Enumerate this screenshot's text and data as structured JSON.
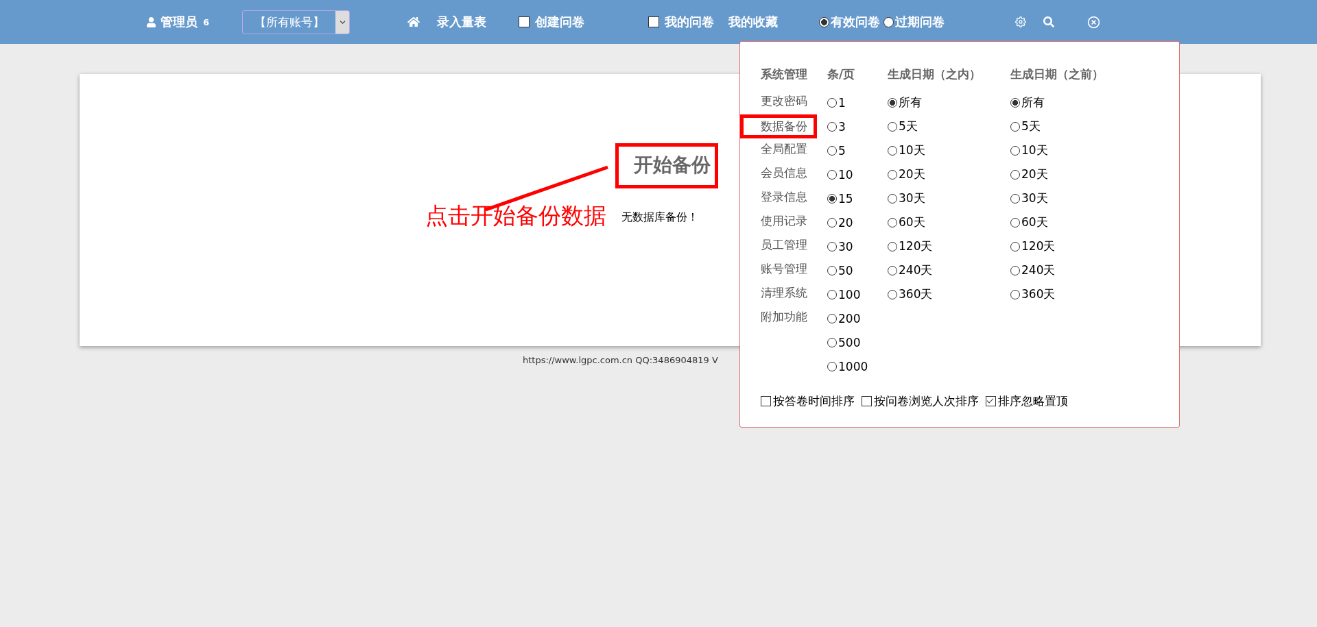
{
  "top_bar": {
    "user": {
      "label": "管理员",
      "count": "6"
    },
    "account_select": {
      "value": "【所有账号】"
    },
    "nav_links": [
      "录入量表"
    ],
    "create_check": {
      "label": "创建问卷",
      "checked": false
    },
    "mine_check": {
      "label": "我的问卷",
      "checked": false
    },
    "favorites": "我的收藏",
    "status_radios": [
      {
        "label": "有效问卷",
        "selected": true
      },
      {
        "label": "过期问卷",
        "selected": false
      }
    ]
  },
  "main": {
    "start_button": "开始备份",
    "message": "无数据库备份！",
    "annotation": "点击开始备份数据"
  },
  "footer": "https://www.lgpc.com.cn QQ:3486904819 V",
  "settings_panel": {
    "menu": {
      "title": "系统管理",
      "items": [
        {
          "label": "更改密码",
          "highlighted": false
        },
        {
          "label": "数据备份",
          "highlighted": true
        },
        {
          "label": "全局配置",
          "highlighted": false
        },
        {
          "label": "会员信息",
          "highlighted": false
        },
        {
          "label": "登录信息",
          "highlighted": false
        },
        {
          "label": "使用记录",
          "highlighted": false
        },
        {
          "label": "员工管理",
          "highlighted": false
        },
        {
          "label": "账号管理",
          "highlighted": false
        },
        {
          "label": "清理系统",
          "highlighted": false
        },
        {
          "label": "附加功能",
          "highlighted": false
        }
      ]
    },
    "per_page": {
      "title": "条/页",
      "options": [
        {
          "label": "1",
          "selected": false
        },
        {
          "label": "3",
          "selected": false
        },
        {
          "label": "5",
          "selected": false
        },
        {
          "label": "10",
          "selected": false
        },
        {
          "label": "15",
          "selected": true
        },
        {
          "label": "20",
          "selected": false
        },
        {
          "label": "30",
          "selected": false
        },
        {
          "label": "50",
          "selected": false
        },
        {
          "label": "100",
          "selected": false
        },
        {
          "label": "200",
          "selected": false
        },
        {
          "label": "500",
          "selected": false
        },
        {
          "label": "1000",
          "selected": false
        }
      ]
    },
    "date_within": {
      "title": "生成日期（之内）",
      "options": [
        {
          "label": "所有",
          "selected": true
        },
        {
          "label": "5天",
          "selected": false
        },
        {
          "label": "10天",
          "selected": false
        },
        {
          "label": "20天",
          "selected": false
        },
        {
          "label": "30天",
          "selected": false
        },
        {
          "label": "60天",
          "selected": false
        },
        {
          "label": "120天",
          "selected": false
        },
        {
          "label": "240天",
          "selected": false
        },
        {
          "label": "360天",
          "selected": false
        }
      ]
    },
    "date_before": {
      "title": "生成日期（之前）",
      "options": [
        {
          "label": "所有",
          "selected": true
        },
        {
          "label": "5天",
          "selected": false
        },
        {
          "label": "10天",
          "selected": false
        },
        {
          "label": "20天",
          "selected": false
        },
        {
          "label": "30天",
          "selected": false
        },
        {
          "label": "60天",
          "selected": false
        },
        {
          "label": "120天",
          "selected": false
        },
        {
          "label": "240天",
          "selected": false
        },
        {
          "label": "360天",
          "selected": false
        }
      ]
    },
    "sort_options": [
      {
        "label": "按答卷时间排序",
        "checked": false
      },
      {
        "label": "按问卷浏览人次排序",
        "checked": false
      },
      {
        "label": "排序忽略置顶",
        "checked": true
      }
    ]
  }
}
